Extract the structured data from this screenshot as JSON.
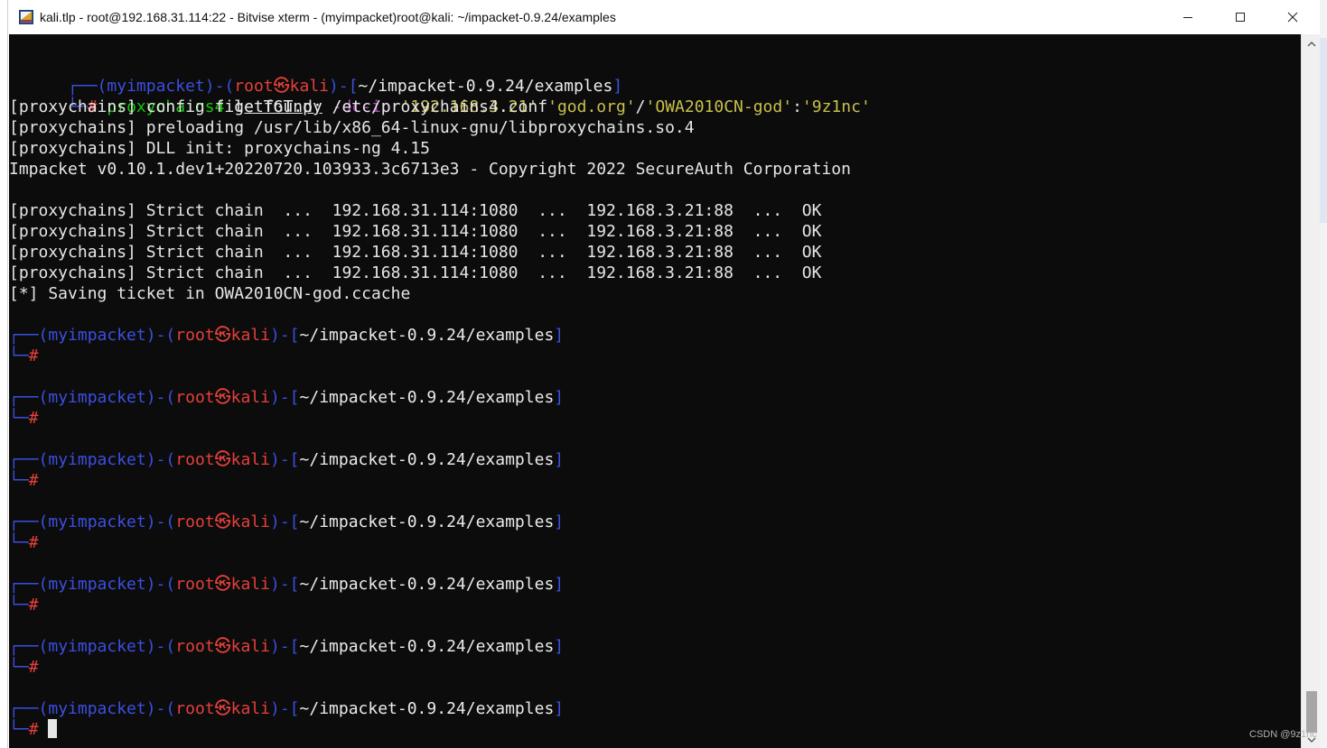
{
  "window": {
    "title": "kali.tlp - root@192.168.31.114:22 - Bitvise xterm - (myimpacket)root@kali: ~/impacket-0.9.24/examples",
    "app_icon": "bitvise-terminal-icon",
    "buttons": {
      "minimize": "minimize-icon",
      "maximize": "maximize-icon",
      "close": "close-icon"
    }
  },
  "prompt": {
    "env": "myimpacket",
    "user": "root",
    "host": "kali",
    "user_host_sep": "㉿",
    "path": "~/impacket-0.9.24/examples",
    "hash": "#",
    "corner_top": "┌──",
    "corner_bottom": "└─",
    "dash": "-",
    "open_paren": "(",
    "close_paren": ")",
    "open_bracket": "[",
    "close_bracket": "]"
  },
  "command": {
    "tool": "proxychains4",
    "script": "getTGT.py",
    "flag": "-dc-ip",
    "arg_ip": "'192.168.3.21'",
    "arg_domain": "'god.org'",
    "slash": "/",
    "arg_user": "'OWA2010CN-god'",
    "colon": ":",
    "arg_pass": "'9z1nc'"
  },
  "output": [
    "[proxychains] config file found: /etc/proxychains4.conf",
    "[proxychains] preloading /usr/lib/x86_64-linux-gnu/libproxychains.so.4",
    "[proxychains] DLL init: proxychains-ng 4.15",
    "Impacket v0.10.1.dev1+20220720.103933.3c6713e3 - Copyright 2022 SecureAuth Corporation",
    "",
    "[proxychains] Strict chain  ...  192.168.31.114:1080  ...  192.168.3.21:88  ...  OK",
    "[proxychains] Strict chain  ...  192.168.31.114:1080  ...  192.168.3.21:88  ...  OK",
    "[proxychains] Strict chain  ...  192.168.31.114:1080  ...  192.168.3.21:88  ...  OK",
    "[proxychains] Strict chain  ...  192.168.31.114:1080  ...  192.168.3.21:88  ...  OK",
    "[*] Saving ticket in OWA2010CN-god.ccache"
  ],
  "watermark": "CSDN @9z1nc",
  "colors": {
    "terminal_bg": "#0c0c0c",
    "prompt_blue": "#3b4fe0",
    "prompt_red": "#e5403a",
    "command_green": "#16c60c",
    "flag_purple": "#b347c2",
    "string_yellow": "#c9c04a",
    "text": "#e6e6e6"
  }
}
